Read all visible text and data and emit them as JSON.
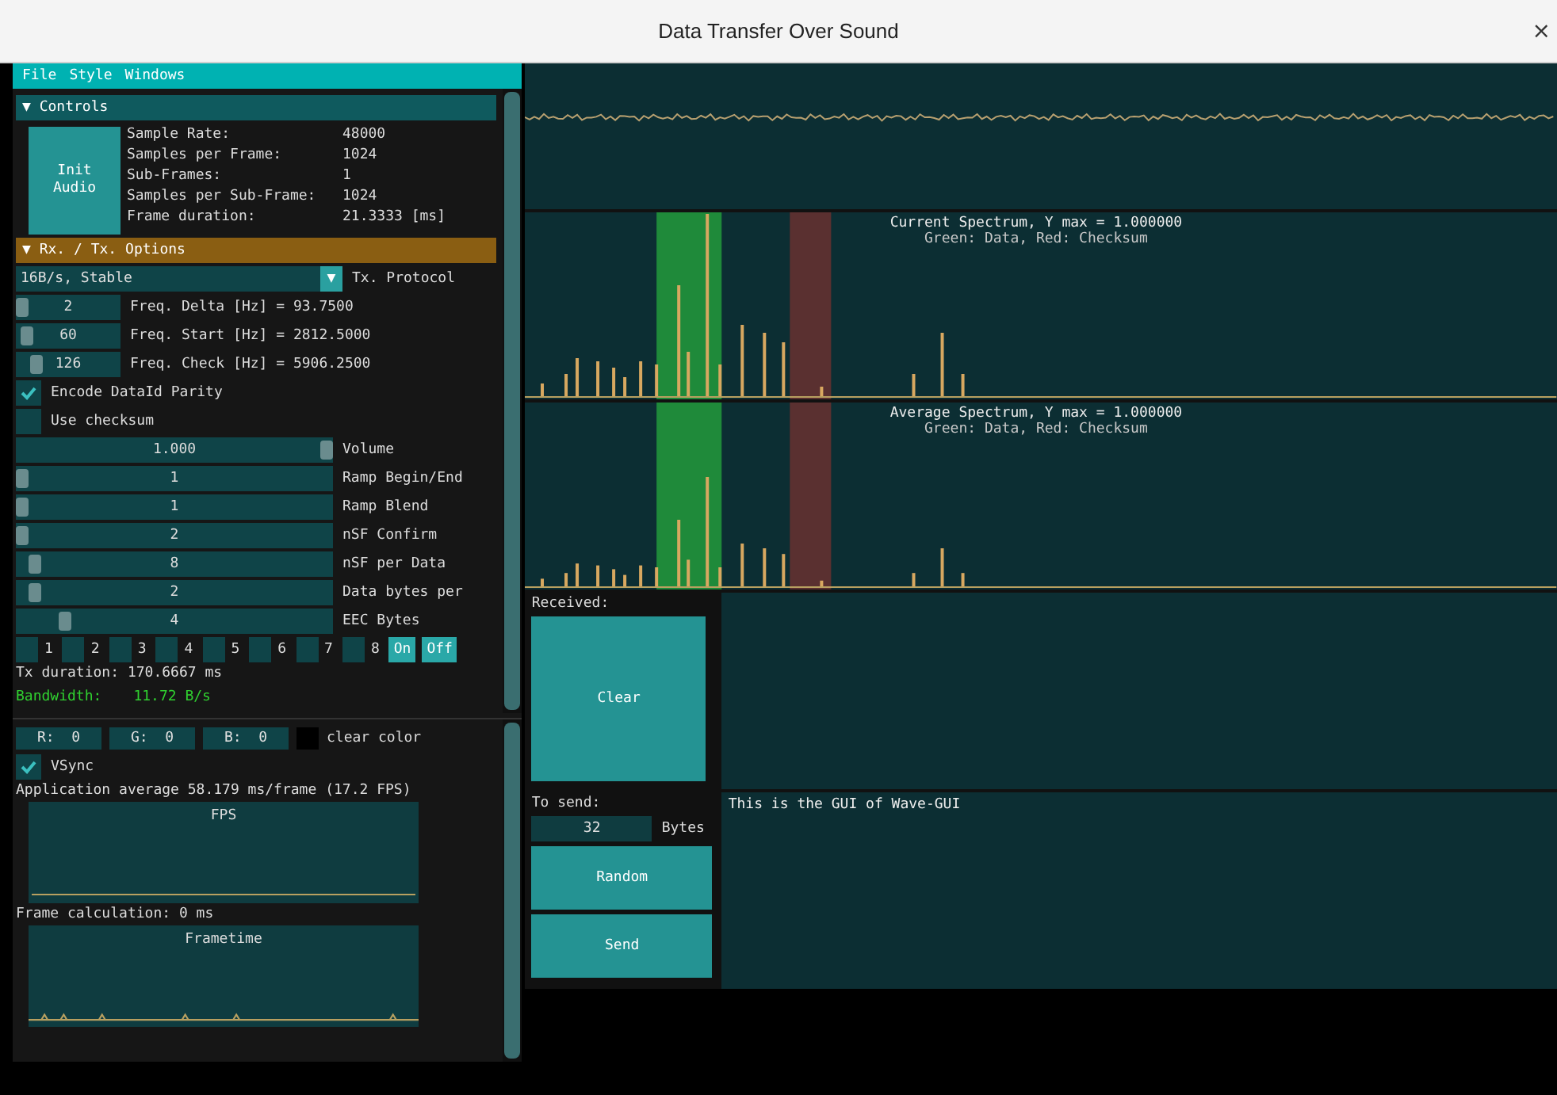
{
  "window": {
    "title": "Data Transfer Over Sound",
    "close": "×"
  },
  "menu": [
    "File",
    "Style",
    "Windows"
  ],
  "controls": {
    "toggle": "▼",
    "title": "Controls",
    "init_button": "Init Audio",
    "info": [
      {
        "label": "Sample Rate:",
        "value": "48000"
      },
      {
        "label": "Samples per Frame:",
        "value": "1024"
      },
      {
        "label": "Sub-Frames:",
        "value": "1"
      },
      {
        "label": "Samples per Sub-Frame:",
        "value": "1024"
      },
      {
        "label": "Frame duration:",
        "value": "21.3333 [ms]"
      }
    ]
  },
  "rx_tx": {
    "toggle": "▼",
    "title": "Rx. / Tx. Options",
    "protocol": {
      "value": "16B/s, Stable",
      "arrow": "▼",
      "label": "Tx. Protocol"
    },
    "freq_sliders": [
      {
        "value": "2",
        "level": 0.0,
        "label": "Freq. Delta [Hz] = 93.7500"
      },
      {
        "value": "60",
        "level": 0.05,
        "label": "Freq. Start [Hz] = 2812.5000"
      },
      {
        "value": "126",
        "level": 0.15,
        "label": "Freq. Check [Hz] = 5906.2500"
      }
    ],
    "checkboxes": [
      {
        "label": "Encode DataId Parity",
        "checked": true
      },
      {
        "label": "Use checksum",
        "checked": false
      }
    ],
    "sliders": [
      {
        "value": "1.000",
        "level": 1.0,
        "label": "Volume"
      },
      {
        "value": "1",
        "level": 0.0,
        "label": "Ramp Begin/End"
      },
      {
        "value": "1",
        "level": 0.0,
        "label": "Ramp Blend"
      },
      {
        "value": "2",
        "level": 0.0,
        "label": "nSF Confirm"
      },
      {
        "value": "8",
        "level": 0.04,
        "label": "nSF per Data"
      },
      {
        "value": "2",
        "level": 0.04,
        "label": "Data bytes per"
      },
      {
        "value": "4",
        "level": 0.14,
        "label": "EEC Bytes"
      }
    ],
    "bits": [
      {
        "label": "1",
        "checked": false
      },
      {
        "label": "2",
        "checked": false
      },
      {
        "label": "3",
        "checked": false
      },
      {
        "label": "4",
        "checked": false
      },
      {
        "label": "5",
        "checked": false
      },
      {
        "label": "6",
        "checked": false
      },
      {
        "label": "7",
        "checked": false
      },
      {
        "label": "8",
        "checked": false
      }
    ],
    "buttons": [
      "On",
      "Off"
    ],
    "tx_duration": "Tx duration: 170.6667 ms",
    "bandwidth": {
      "label": "Bandwidth:",
      "value": "11.72 B/s"
    }
  },
  "display": {
    "rgb": [
      {
        "label": "R:",
        "value": "0"
      },
      {
        "label": "G:",
        "value": "0"
      },
      {
        "label": "B:",
        "value": "0"
      }
    ],
    "clear_color": "clear color",
    "vsync": {
      "label": "VSync",
      "checked": true
    },
    "app_average": "Application average 58.179 ms/frame (17.2 FPS)",
    "fps_plot": "FPS",
    "frame_calc": "Frame calculation: 0 ms",
    "frametime_plot": "Frametime"
  },
  "spectra": [
    {
      "title": "Current Spectrum, Y max = 1.000000",
      "subtitle": "Green: Data, Red: Checksum"
    },
    {
      "title": "Average Spectrum, Y max = 1.000000",
      "subtitle": "Green: Data, Red: Checksum"
    }
  ],
  "received": {
    "label": "Received:",
    "button": "Clear"
  },
  "to_send": {
    "label": "To send:",
    "bytes_value": "32",
    "bytes_label": "Bytes",
    "buttons": [
      "Random",
      "Send"
    ],
    "text": "This is the GUI of Wave-GUI"
  }
}
